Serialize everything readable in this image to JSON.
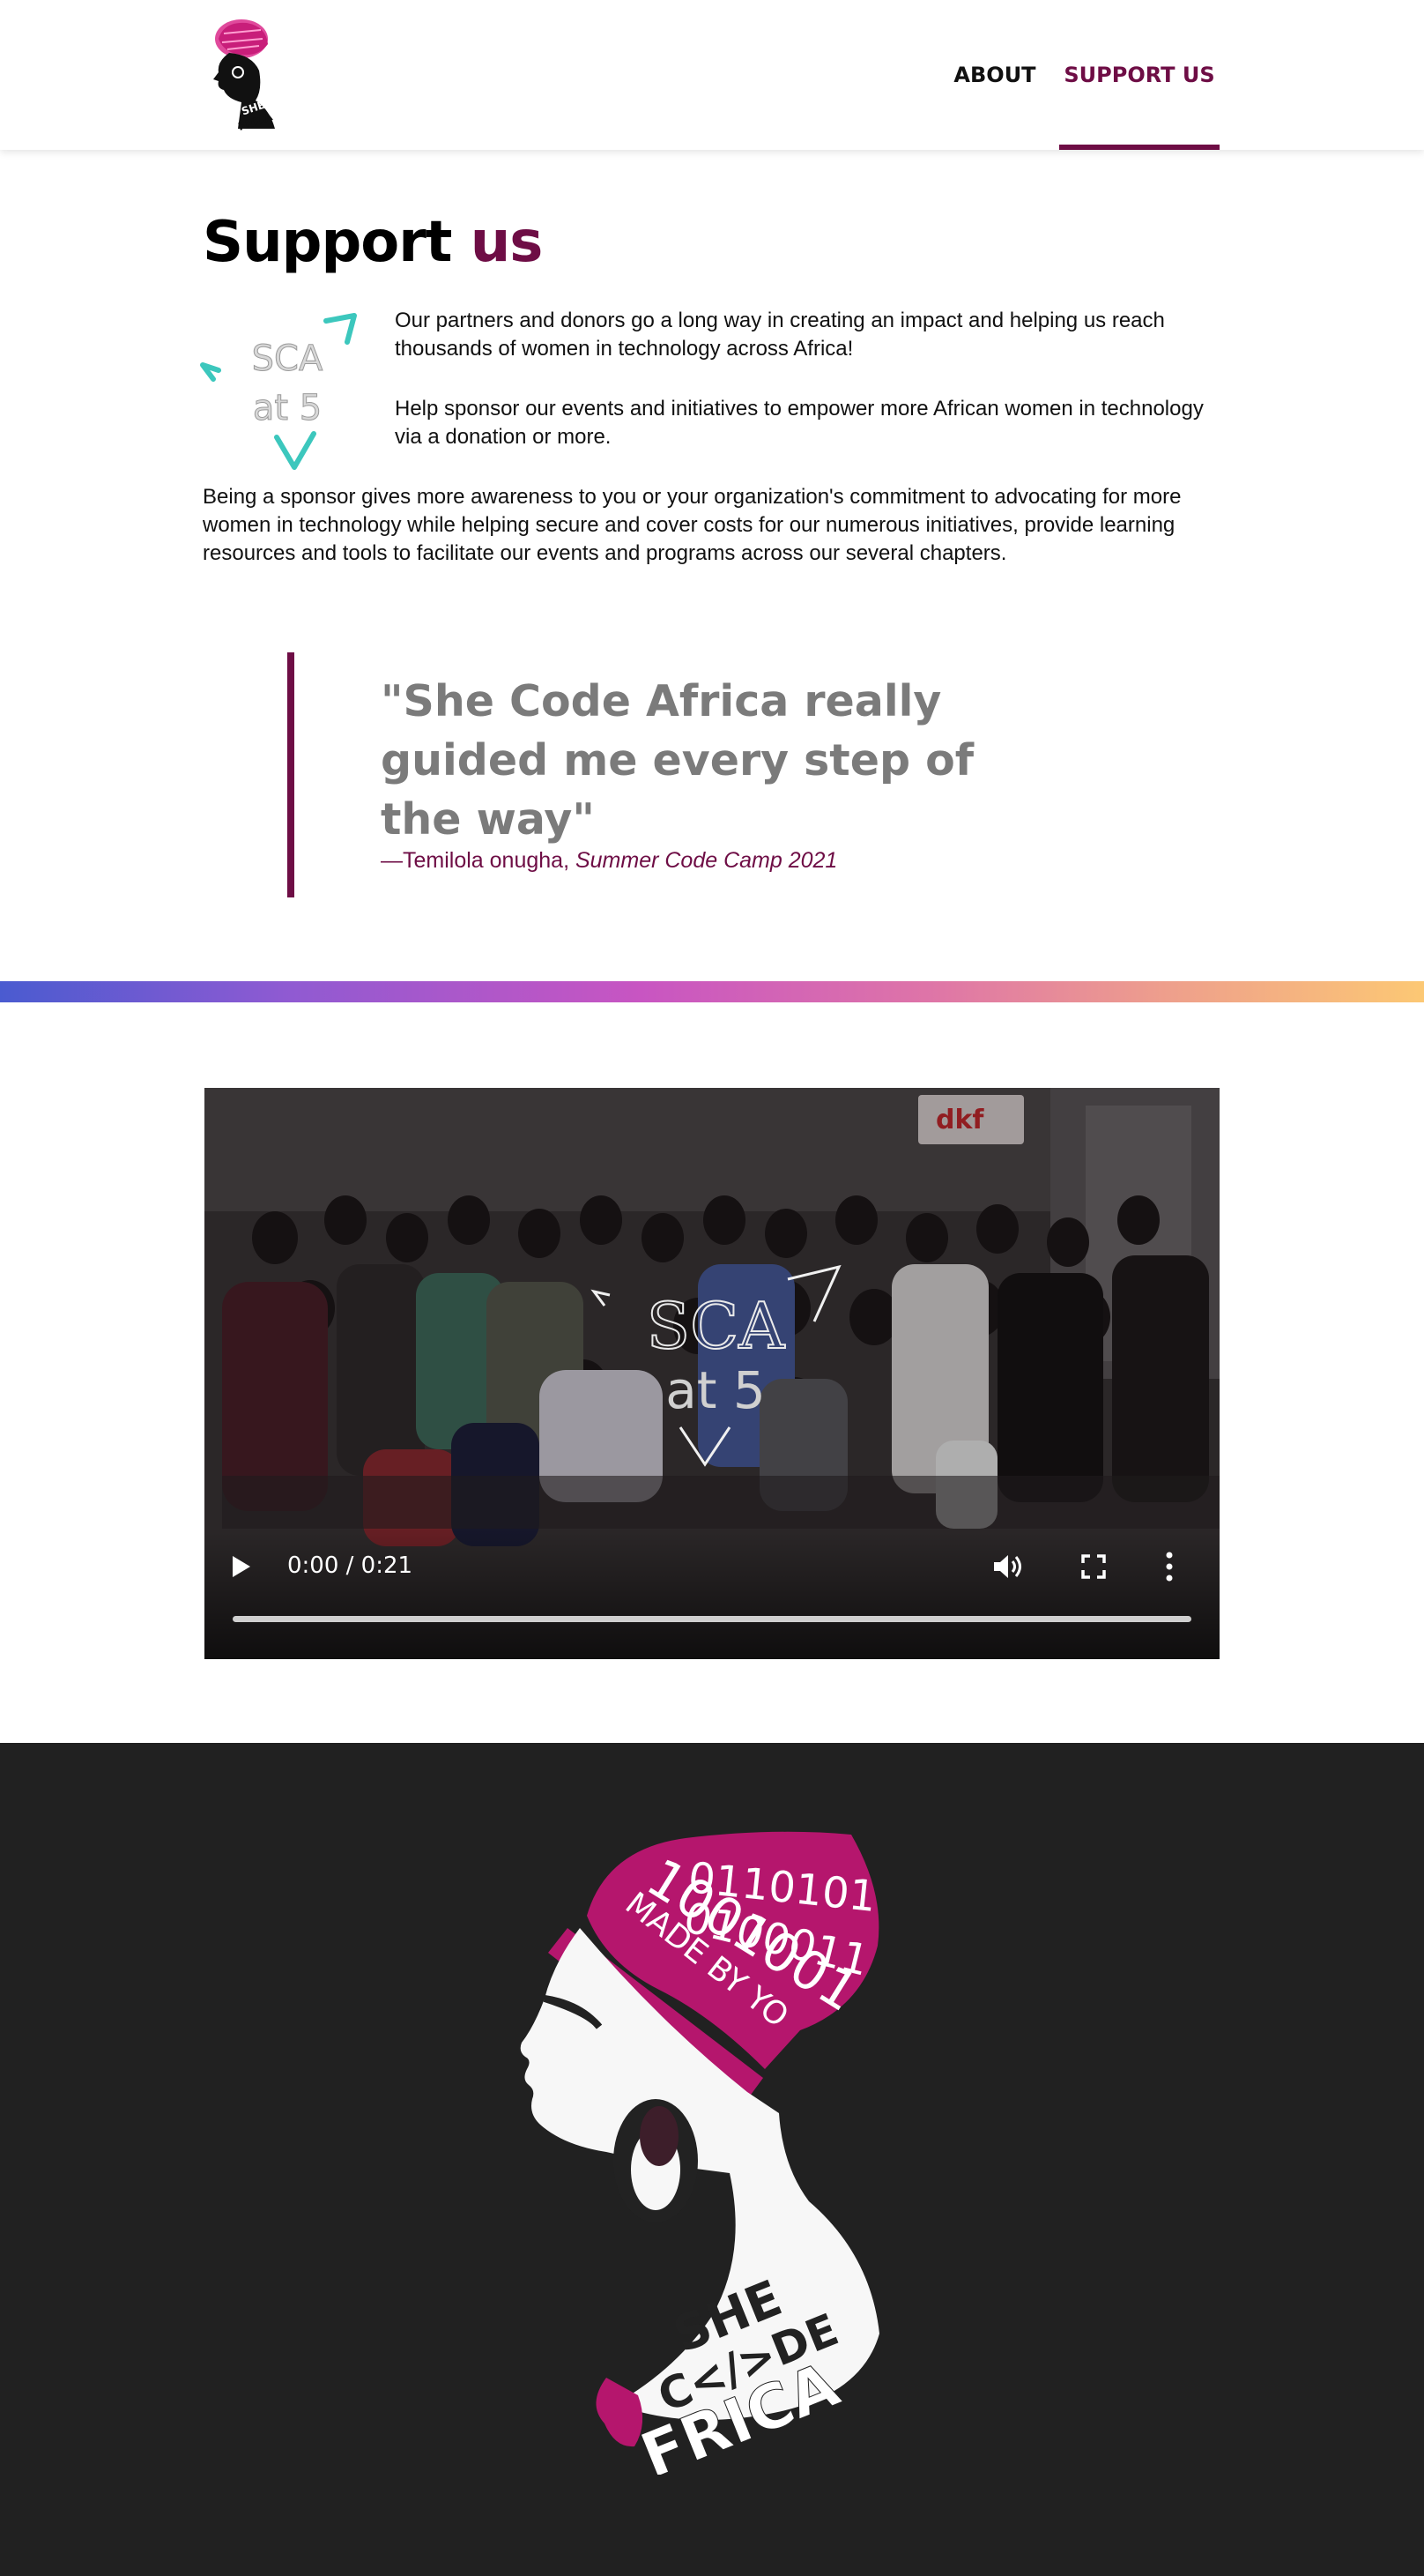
{
  "header": {
    "logo_alt": "She Code Africa logo",
    "nav": [
      {
        "label": "ABOUT"
      },
      {
        "label": "SUPPORT US",
        "active": true
      }
    ]
  },
  "page": {
    "title_part1": "Support",
    "title_part2": "us",
    "badge": {
      "line1": "SCA",
      "line2": "at 5"
    },
    "intro_p1": "Our partners and donors go a long way in creating an impact and helping us reach thousands of women in technology across Africa!",
    "intro_p2": "Help sponsor our events and initiatives to empower more African women in technology via a donation or more.",
    "intro_p3": "Being a sponsor gives more awareness to you or your organization's commitment to advocating for more women in technology while helping secure and cover costs for our numerous initiatives, provide learning resources and tools to facilitate our events and programs across our several chapters."
  },
  "quote": {
    "text": "\"She Code Africa really guided me every step of the way\"",
    "author": "—Temilola onugha, ",
    "source": "Summer Code Camp 2021"
  },
  "video": {
    "overlay_line1": "SCA",
    "overlay_line2": "at 5",
    "time": "0:00 / 0:21",
    "progress": 0,
    "banner_text": "dkf"
  },
  "footer_logo": {
    "code_line1": "0110101",
    "code_line2": "0100011",
    "code_line3": "1001001",
    "wrap_text": "MADE BY YO",
    "brand_line1": "SHE",
    "brand_line2": "C</>DE",
    "brand_line3": "FRICA"
  },
  "colors": {
    "brand_plum": "#6e0d45",
    "brand_magenta": "#b5166d",
    "teal_accent": "#3cc7bd",
    "footer_bg": "#212121",
    "quote_grey": "#7b7b7b"
  },
  "icons": [
    "play-icon",
    "volume-icon",
    "fullscreen-icon",
    "more-vert-icon"
  ]
}
